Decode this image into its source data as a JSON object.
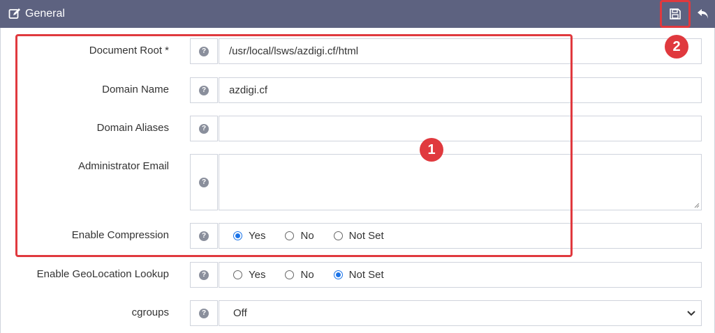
{
  "header": {
    "title": "General",
    "icons": {
      "edit": "edit-square-icon",
      "save": "save-disk-icon",
      "undo": "undo-arrow-icon"
    }
  },
  "fields": {
    "document_root": {
      "label": "Document Root *",
      "value": "/usr/local/lsws/azdigi.cf/html"
    },
    "domain_name": {
      "label": "Domain Name",
      "value": "azdigi.cf"
    },
    "domain_aliases": {
      "label": "Domain Aliases",
      "value": ""
    },
    "admin_email": {
      "label": "Administrator Email",
      "value": ""
    },
    "enable_compression": {
      "label": "Enable Compression",
      "options": [
        "Yes",
        "No",
        "Not Set"
      ],
      "selected": "Yes"
    },
    "enable_geolocation": {
      "label": "Enable GeoLocation Lookup",
      "options": [
        "Yes",
        "No",
        "Not Set"
      ],
      "selected": "Not Set"
    },
    "cgroups": {
      "label": "cgroups",
      "value": "Off"
    }
  },
  "help_glyph": "?",
  "annotations": {
    "box1": "1",
    "box2": "2"
  },
  "colors": {
    "header_bg": "#5d6280",
    "annotation": "#e0393e",
    "radio_active": "#1a73e8"
  }
}
